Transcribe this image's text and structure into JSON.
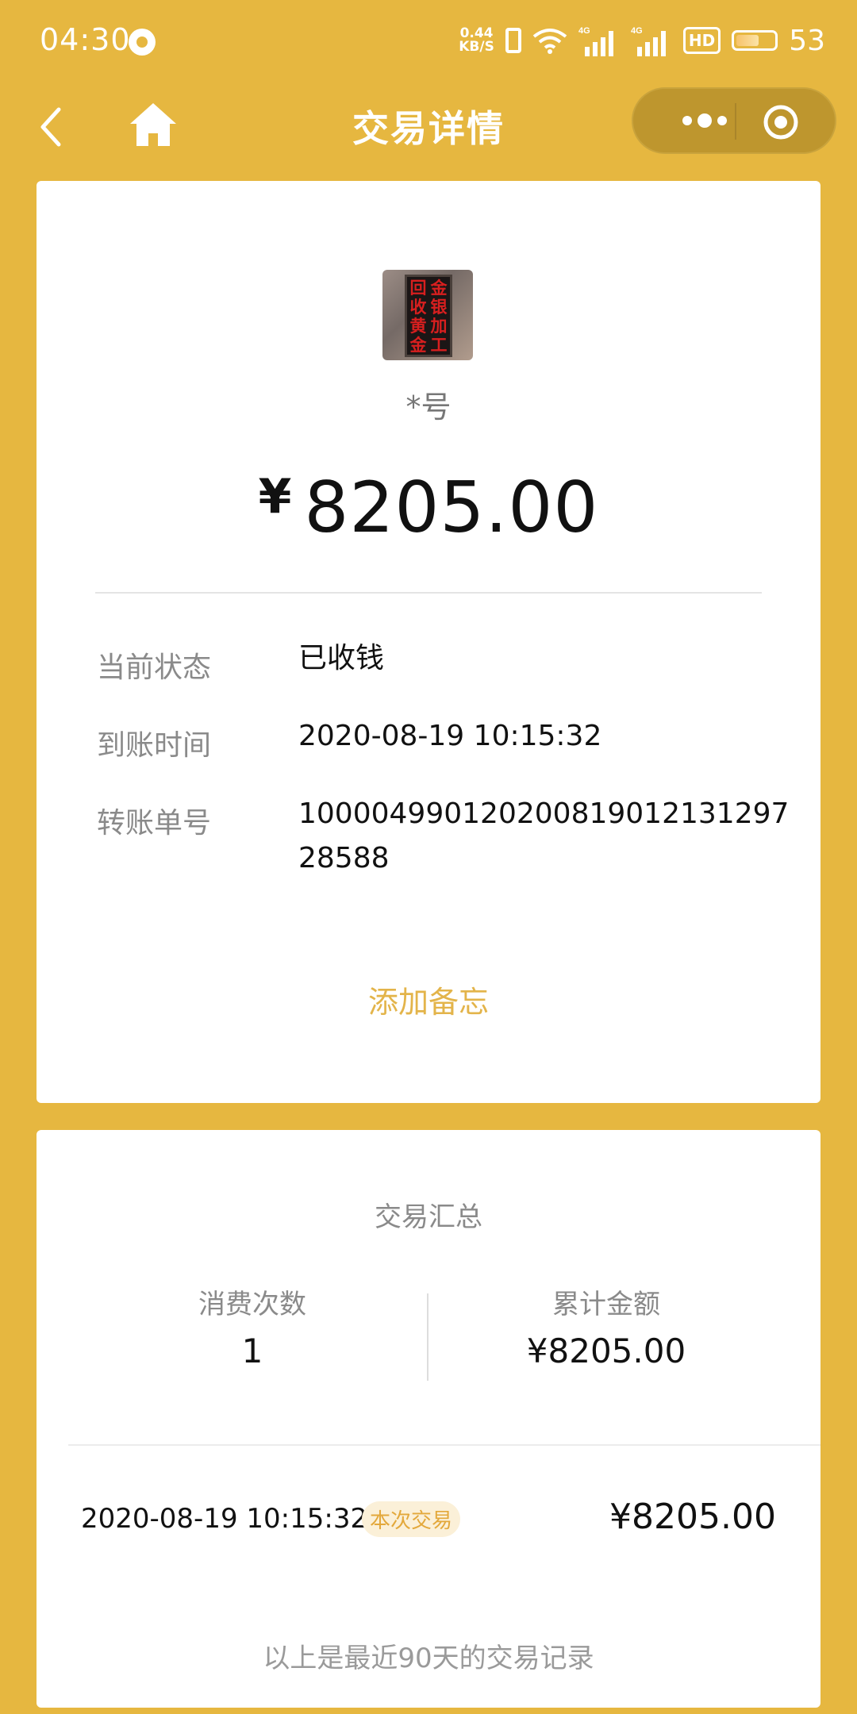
{
  "status_bar": {
    "time": "04:30",
    "speed_value": "0.44",
    "speed_unit": "KB/S",
    "network_1": "4G",
    "network_2": "4G",
    "hd_label": "HD",
    "battery_percent": "53"
  },
  "nav": {
    "title": "交易详情",
    "icons": [
      "back-icon",
      "home-icon",
      "more-icon",
      "close-mini-program-icon"
    ]
  },
  "transaction": {
    "avatar_sign_text": [
      "回",
      "金",
      "收",
      "银",
      "黄",
      "加",
      "金",
      "工"
    ],
    "payee": "*号",
    "currency": "¥",
    "amount": "8205.00",
    "rows": [
      {
        "label": "当前状态",
        "value": "已收钱"
      },
      {
        "label": "到账时间",
        "value": "2020-08-19 10:15:32"
      },
      {
        "label": "转账单号",
        "value": "100004990120200819012131297 28588"
      }
    ],
    "add_note": "添加备忘"
  },
  "summary": {
    "title": "交易汇总",
    "count_label": "消费次数",
    "count_value": "1",
    "total_label": "累计金额",
    "total_value": "¥8205.00",
    "record": {
      "time": "2020-08-19 10:15:32",
      "badge": "本次交易",
      "amount": "¥8205.00"
    },
    "footer": "以上是最近90天的交易记录"
  },
  "colors": {
    "background": "#E6B740",
    "accent": "#E3B44A",
    "capsule": "#BE962E"
  }
}
